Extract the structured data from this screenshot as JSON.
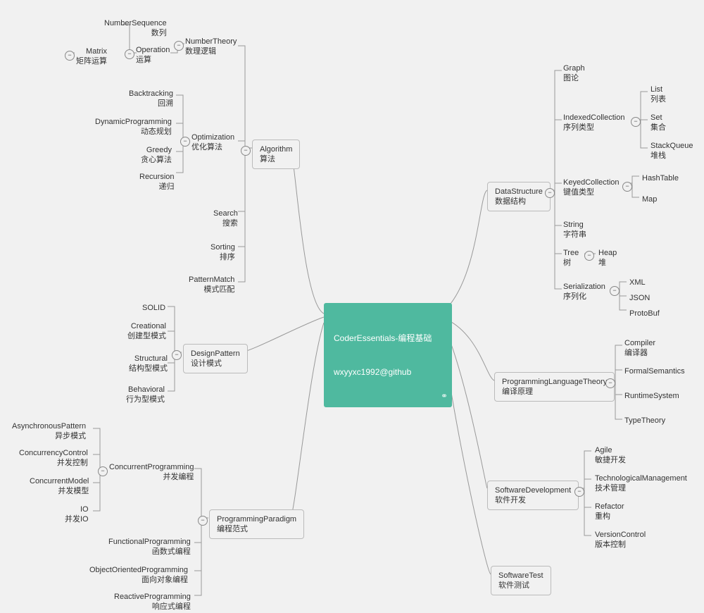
{
  "root": {
    "title": "CoderEssentials-编程基础",
    "subtitle": "wxyyxc1992@github"
  },
  "left": {
    "algorithm": {
      "en": "Algorithm",
      "zh": "算法",
      "children": {
        "numtheory": {
          "en": "NumberTheory",
          "zh": "数理逻辑",
          "children": {
            "operation": {
              "en": "Operation",
              "zh": "运算",
              "children": {
                "numseq": {
                  "en": "NumberSequence",
                  "zh": "数列"
                },
                "matrix": {
                  "en": "Matrix",
                  "zh": "矩阵运算"
                }
              }
            }
          }
        },
        "optimization": {
          "en": "Optimization",
          "zh": "优化算法",
          "children": {
            "backtrack": {
              "en": "Backtracking",
              "zh": "回溯"
            },
            "dp": {
              "en": "DynamicProgramming",
              "zh": "动态规划"
            },
            "greedy": {
              "en": "Greedy",
              "zh": "贪心算法"
            },
            "recursion": {
              "en": "Recursion",
              "zh": "递归"
            }
          }
        },
        "search": {
          "en": "Search",
          "zh": "搜索"
        },
        "sorting": {
          "en": "Sorting",
          "zh": "排序"
        },
        "pattern": {
          "en": "PatternMatch",
          "zh": "模式匹配"
        }
      }
    },
    "designpattern": {
      "en": "DesignPattern",
      "zh": "设计模式",
      "children": {
        "solid": {
          "en": "SOLID",
          "zh": ""
        },
        "creational": {
          "en": "Creational",
          "zh": "创建型模式"
        },
        "structural": {
          "en": "Structural",
          "zh": "结构型模式"
        },
        "behavioral": {
          "en": "Behavioral",
          "zh": "行为型模式"
        }
      }
    },
    "paradigm": {
      "en": "ProgrammingParadigm",
      "zh": "编程范式",
      "children": {
        "concurrent": {
          "en": "ConcurrentProgramming",
          "zh": "并发编程",
          "children": {
            "async": {
              "en": "AsynchronousPattern",
              "zh": "异步模式"
            },
            "ctrl": {
              "en": "ConcurrencyControl",
              "zh": "并发控制"
            },
            "model": {
              "en": "ConcurrentModel",
              "zh": "并发模型"
            },
            "io": {
              "en": "IO",
              "zh": "并发IO"
            }
          }
        },
        "fp": {
          "en": "FunctionalProgramming",
          "zh": "函数式编程"
        },
        "oop": {
          "en": "ObjectOrientedProgramming",
          "zh": "面向对象编程"
        },
        "reactive": {
          "en": "ReactiveProgramming",
          "zh": "响应式编程"
        }
      }
    }
  },
  "right": {
    "datastructure": {
      "en": "DataStructure",
      "zh": "数据结构",
      "children": {
        "graph": {
          "en": "Graph",
          "zh": "图论"
        },
        "indexed": {
          "en": "IndexedCollection",
          "zh": "序列类型",
          "children": {
            "list": {
              "en": "List",
              "zh": "列表"
            },
            "set": {
              "en": "Set",
              "zh": "集合"
            },
            "stackq": {
              "en": "StackQueue",
              "zh": "堆栈"
            }
          }
        },
        "keyed": {
          "en": "KeyedCollection",
          "zh": "键值类型",
          "children": {
            "hash": {
              "en": "HashTable",
              "zh": ""
            },
            "map": {
              "en": "Map",
              "zh": ""
            }
          }
        },
        "string": {
          "en": "String",
          "zh": "字符串"
        },
        "tree": {
          "en": "Tree",
          "zh": "树",
          "children": {
            "heap": {
              "en": "Heap",
              "zh": "堆"
            }
          }
        },
        "serial": {
          "en": "Serialization",
          "zh": "序列化",
          "children": {
            "xml": {
              "en": "XML",
              "zh": ""
            },
            "json": {
              "en": "JSON",
              "zh": ""
            },
            "proto": {
              "en": "ProtoBuf",
              "zh": ""
            }
          }
        }
      }
    },
    "plt": {
      "en": "ProgrammingLanguageTheory",
      "zh": "编译原理",
      "children": {
        "compiler": {
          "en": "Compiler",
          "zh": "编译器"
        },
        "formal": {
          "en": "FormalSemantics",
          "zh": ""
        },
        "runtime": {
          "en": "RuntimeSystem",
          "zh": ""
        },
        "typetheory": {
          "en": "TypeTheory",
          "zh": ""
        }
      }
    },
    "softdev": {
      "en": "SoftwareDevelopment",
      "zh": "软件开发",
      "children": {
        "agile": {
          "en": "Agile",
          "zh": "敏捷开发"
        },
        "techmgmt": {
          "en": "TechnologicalManagement",
          "zh": "技术管理"
        },
        "refactor": {
          "en": "Refactor",
          "zh": "重构"
        },
        "vc": {
          "en": "VersionControl",
          "zh": "版本控制"
        }
      }
    },
    "softtest": {
      "en": "SoftwareTest",
      "zh": "软件测试"
    }
  },
  "toggle_glyph": "−"
}
